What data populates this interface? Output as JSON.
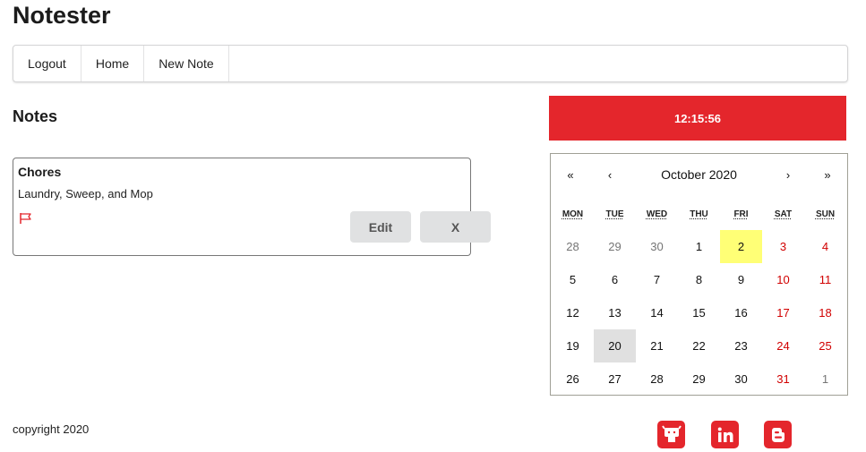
{
  "app": {
    "title": "Notester"
  },
  "nav": {
    "items": [
      "Logout",
      "Home",
      "New Note"
    ]
  },
  "notes": {
    "heading": "Notes",
    "items": [
      {
        "title": "Chores",
        "body": "Laundry, Sweep, and Mop",
        "edit_label": "Edit",
        "delete_label": "X"
      }
    ]
  },
  "clock": {
    "time": "12:15:56"
  },
  "calendar": {
    "prev2": "«",
    "prev": "‹",
    "label": "October 2020",
    "next": "›",
    "next2": "»",
    "weekdays": [
      "MON",
      "TUE",
      "WED",
      "THU",
      "FRI",
      "SAT",
      "SUN"
    ],
    "days": [
      [
        "28",
        "29",
        "30",
        "1",
        "2",
        "3",
        "4"
      ],
      [
        "5",
        "6",
        "7",
        "8",
        "9",
        "10",
        "11"
      ],
      [
        "12",
        "13",
        "14",
        "15",
        "16",
        "17",
        "18"
      ],
      [
        "19",
        "20",
        "21",
        "22",
        "23",
        "24",
        "25"
      ],
      [
        "26",
        "27",
        "28",
        "29",
        "30",
        "31",
        "1"
      ]
    ],
    "today": "2",
    "selected": "20"
  },
  "footer": {
    "copyright": "copyright 2020",
    "social_icons": [
      "github-icon",
      "linkedin-icon",
      "blogger-icon"
    ]
  },
  "colors": {
    "accent": "#e4262c",
    "today_highlight": "#ffff76",
    "selected_highlight": "#e0e0e0",
    "weekend": "#d10000"
  }
}
